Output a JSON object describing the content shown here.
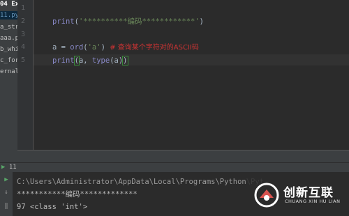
{
  "project_panel": {
    "items": [
      "04 Ex",
      "11.py",
      "a_str.py",
      "aaa.py",
      "b_whil",
      "c_for.p",
      "ernal L"
    ]
  },
  "editor": {
    "line_numbers": [
      "1",
      "2",
      "3",
      "4",
      "5"
    ],
    "line2": {
      "fn": "print",
      "open": "(",
      "str": "'**********编码************'",
      "close": ")"
    },
    "line4": {
      "var": "a = ",
      "fn": "ord",
      "open": "(",
      "str": "'a'",
      "close": ")",
      "comment": "  # 查询某个字符对的ASCII码"
    },
    "line5": {
      "fn": "print",
      "open": "(",
      "args": "a, ",
      "fn2": "type",
      "inner": "(a)",
      "close": ")"
    }
  },
  "run_panel": {
    "tab_label": "11",
    "lines": [
      "C:\\Users\\Administrator\\AppData\\Local\\Programs\\Python\\Pyt",
      "***********编码*************",
      "97 <class 'int'>"
    ]
  },
  "watermark": {
    "cn": "创新互联",
    "en": "CHUANG XIN HU LIAN",
    "color": "#d9534f"
  }
}
